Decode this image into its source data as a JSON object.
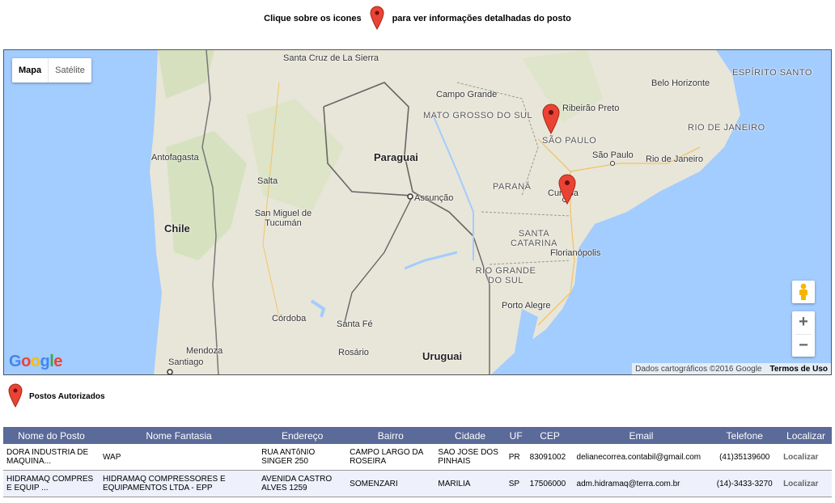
{
  "header": {
    "before_icon": "Clique sobre os icones",
    "after_icon": "para ver informações detalhadas do posto"
  },
  "map": {
    "type_control": {
      "map": "Mapa",
      "satellite": "Satélite"
    },
    "logo": "Google",
    "attribution": "Dados cartográficos ©2016 Google",
    "terms": "Termos de Uso",
    "zoom_in": "+",
    "zoom_out": "−",
    "labels": {
      "santa_cruz": "Santa Cruz de La Sierra",
      "campo_grande": "Campo Grande",
      "mato_grosso": "MATO GROSSO DO SUL",
      "ribeirao": "Ribeirão Preto",
      "belo_horizonte": "Belo Horizonte",
      "espirito_santo": "ESPÍRITO SANTO",
      "sao_paulo_state": "SÃO PAULO",
      "rio_state": "RIO DE JANEIRO",
      "sao_paulo": "São Paulo",
      "rio": "Rio de Janeiro",
      "antofagasta": "Antofagasta",
      "paraguai": "Paraguai",
      "parana": "PARANÁ",
      "curitiba": "Curitiba",
      "salta": "Salta",
      "assuncao": "Assunção",
      "tucuman": "San Miguel de Tucumán",
      "chile": "Chile",
      "santa_catarina": "SANTA CATARINA",
      "florianopolis": "Florianópolis",
      "rio_grande": "RIO GRANDE DO SUL",
      "porto_alegre": "Porto Alegre",
      "cordoba": "Córdoba",
      "santa_fe": "Santa Fé",
      "mendoza": "Mendoza",
      "rosario": "Rosário",
      "uruguai": "Uruguai",
      "santiago": "Santiago"
    }
  },
  "legend": {
    "label": "Postos Autorizados"
  },
  "table": {
    "headers": [
      "Nome do Posto",
      "Nome Fantasia",
      "Endereço",
      "Bairro",
      "Cidade",
      "UF",
      "CEP",
      "Email",
      "Telefone",
      "Localizar"
    ],
    "rows": [
      {
        "nome": "DORA INDUSTRIA DE MAQUINA...",
        "fantasia": "WAP",
        "endereco": "RUA ANTôNIO SINGER 250",
        "bairro": "CAMPO LARGO DA ROSEIRA",
        "cidade": "SAO JOSE DOS PINHAIS",
        "uf": "PR",
        "cep": "83091002",
        "email": "delianecorrea.contabil@gmail.com",
        "telefone": "(41)35139600",
        "localizar": "Localizar"
      },
      {
        "nome": "HIDRAMAQ COMPRES E EQUIP ...",
        "fantasia": "HIDRAMAQ COMPRESSORES E EQUIPAMENTOS LTDA - EPP",
        "endereco": "AVENIDA CASTRO ALVES 1259",
        "bairro": "SOMENZARI",
        "cidade": "MARILIA",
        "uf": "SP",
        "cep": "17506000",
        "email": "adm.hidramaq@terra.com.br",
        "telefone": "(14)-3433-3270",
        "localizar": "Localizar"
      }
    ]
  },
  "colors": {
    "pin": "#ea4335",
    "header_bg": "#5a6a99",
    "ocean": "#a3ccff",
    "land": "#e8e6d8"
  }
}
